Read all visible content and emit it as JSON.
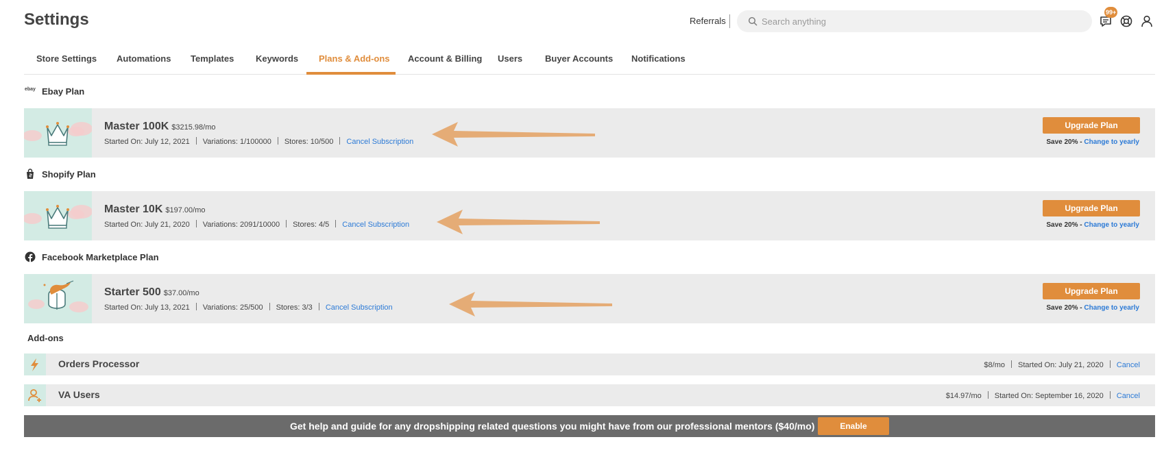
{
  "header": {
    "title": "Settings",
    "referrals": "Referrals",
    "search_placeholder": "Search anything",
    "notification_badge": "99+"
  },
  "tabs": [
    {
      "label": "Store Settings",
      "active": false
    },
    {
      "label": "Automations",
      "active": false
    },
    {
      "label": "Templates",
      "active": false
    },
    {
      "label": "Keywords",
      "active": false
    },
    {
      "label": "Plans & Add-ons",
      "active": true
    },
    {
      "label": "Account & Billing",
      "active": false
    },
    {
      "label": "Users",
      "active": false
    },
    {
      "label": "Buyer Accounts",
      "active": false
    },
    {
      "label": "Notifications",
      "active": false
    }
  ],
  "plans": [
    {
      "section": "Ebay Plan",
      "section_icon": "ebay-logo-icon",
      "section_icon_text": "ebay",
      "name": "Master 100K",
      "price": "$3215.98/mo",
      "started": "Started On: July 12, 2021",
      "variations": "Variations: 1/100000",
      "stores": "Stores: 10/500",
      "cancel": "Cancel Subscription",
      "upgrade": "Upgrade Plan",
      "save": "Save 20% -",
      "change_yearly": "Change to yearly",
      "thumb_icon": "crown-icon"
    },
    {
      "section": "Shopify Plan",
      "section_icon": "shopify-bag-icon",
      "name": "Master 10K",
      "price": "$197.00/mo",
      "started": "Started On: July 21, 2020",
      "variations": "Variations: 2091/10000",
      "stores": "Stores: 4/5",
      "cancel": "Cancel Subscription",
      "upgrade": "Upgrade Plan",
      "save": "Save 20% -",
      "change_yearly": "Change to yearly",
      "thumb_icon": "crown-icon"
    },
    {
      "section": "Facebook Marketplace Plan",
      "section_icon": "facebook-icon",
      "name": "Starter 500",
      "price": "$37.00/mo",
      "started": "Started On: July 13, 2021",
      "variations": "Variations: 25/500",
      "stores": "Stores: 3/3",
      "cancel": "Cancel Subscription",
      "upgrade": "Upgrade Plan",
      "save": "Save 20% -",
      "change_yearly": "Change to yearly",
      "thumb_icon": "knight-helmet-icon"
    }
  ],
  "addons": {
    "title": "Add-ons",
    "items": [
      {
        "name": "Orders Processor",
        "price": "$8/mo",
        "started": "Started On: July 21, 2020",
        "cancel": "Cancel",
        "icon": "lightning-icon"
      },
      {
        "name": "VA Users",
        "price": "$14.97/mo",
        "started": "Started On: September 16, 2020",
        "cancel": "Cancel",
        "icon": "add-user-icon"
      }
    ]
  },
  "mentor": {
    "text": "Get help and guide for any dropshipping related questions you might have from our professional mentors ($40/mo)",
    "button": "Enable"
  },
  "colors": {
    "accent": "#e08d3c",
    "link": "#2c7ad6",
    "card_bg": "#ebebeb",
    "thumb_bg": "#d3ebe4",
    "arrow": "#e5ac76"
  }
}
